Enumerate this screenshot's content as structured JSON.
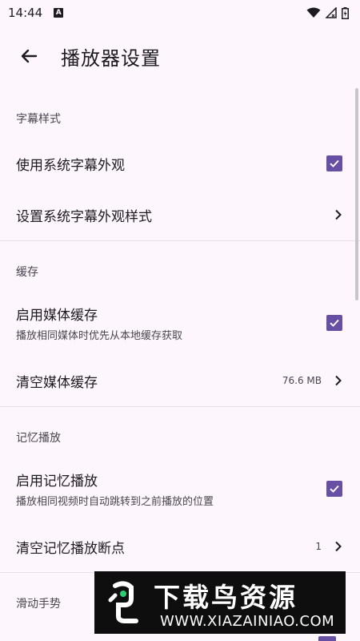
{
  "status_bar": {
    "time": "14:44",
    "notification": "A"
  },
  "app_bar": {
    "title": "播放器设置"
  },
  "sections": [
    {
      "header": "字幕样式",
      "rows": [
        {
          "label": "使用系统字幕外观",
          "control": "checkbox",
          "checked": true
        },
        {
          "label": "设置系统字幕外观样式",
          "control": "chevron"
        }
      ]
    },
    {
      "header": "缓存",
      "rows": [
        {
          "label": "启用媒体缓存",
          "subtitle": "播放相同媒体时优先从本地缓存获取",
          "control": "checkbox",
          "checked": true
        },
        {
          "label": "清空媒体缓存",
          "value": "76.6 MB",
          "control": "chevron"
        }
      ]
    },
    {
      "header": "记忆播放",
      "rows": [
        {
          "label": "启用记忆播放",
          "subtitle": "播放相同视频时自动跳转到之前播放的位置",
          "control": "checkbox",
          "checked": true
        },
        {
          "label": "清空记忆播放断点",
          "value": "1",
          "control": "chevron"
        }
      ]
    },
    {
      "header": "滑动手势",
      "rows": []
    }
  ],
  "watermark": {
    "title": "下载鸟资源",
    "url": "WWW.XIAZAINIAO.COM"
  },
  "colors": {
    "accent": "#6750a4",
    "background": "#fdf7fd"
  }
}
